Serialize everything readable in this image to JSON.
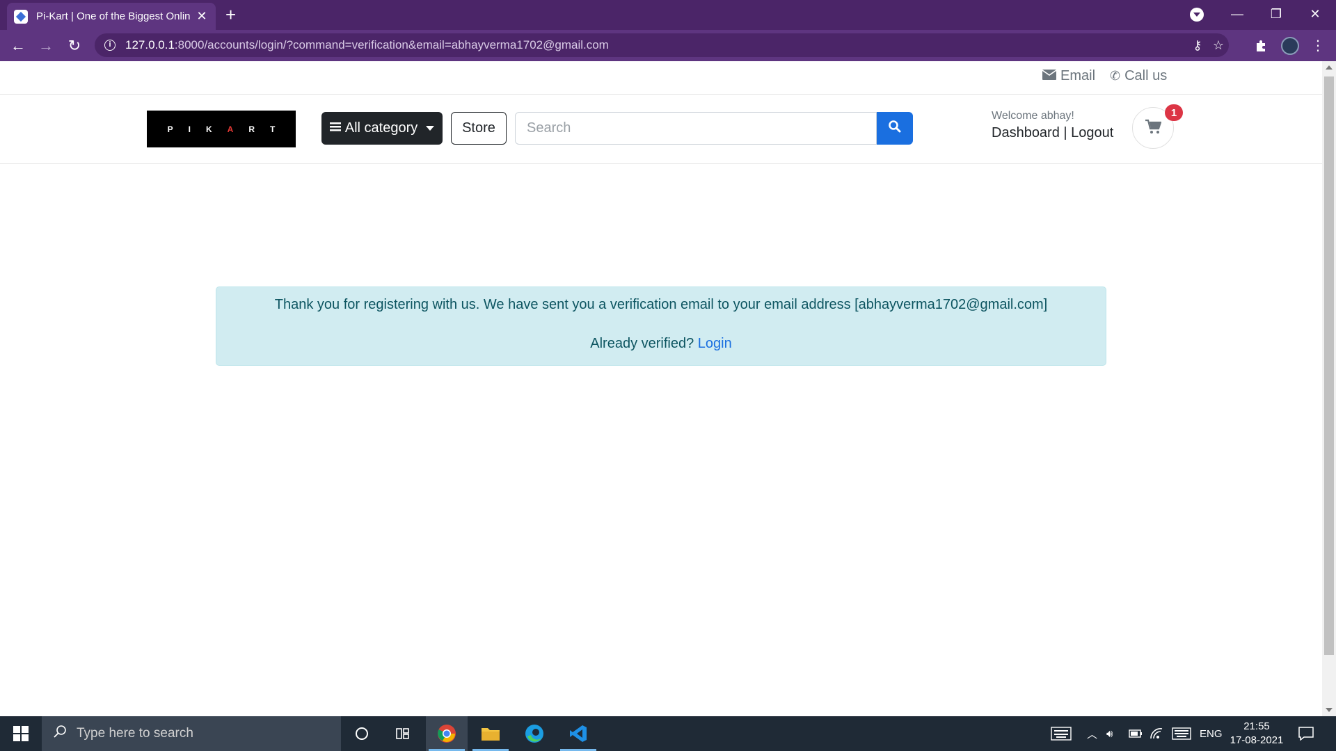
{
  "browser": {
    "tab_title": "Pi-Kart | One of the Biggest Onlin",
    "url_host": "127.0.0.1",
    "url_rest": ":8000/accounts/login/?command=verification&email=abhayverma1702@gmail.com"
  },
  "topbar": {
    "email_label": "Email",
    "call_label": "Call us"
  },
  "header": {
    "logo_text_a": "PIK",
    "logo_text_b": "A",
    "logo_text_c": "RT",
    "category_label": "All category",
    "store_label": "Store",
    "search_placeholder": "Search",
    "welcome": "Welcome abhay!",
    "dashboard_label": "Dashboard",
    "separator": " | ",
    "logout_label": "Logout",
    "cart_count": "1"
  },
  "alert": {
    "message": "Thank you for registering with us. We have sent you a verification email to your email address [abhayverma1702@gmail.com]",
    "verified_prefix": "Already verified? ",
    "login_label": "Login"
  },
  "taskbar": {
    "search_placeholder": "Type here to search",
    "language": "ENG",
    "time": "21:55",
    "date": "17-08-2021"
  },
  "colors": {
    "browser_frame": "#4b2568",
    "alert_bg": "#d1ecf1",
    "alert_text": "#0c5460",
    "primary": "#1a6fe0",
    "badge": "#dc3545"
  }
}
